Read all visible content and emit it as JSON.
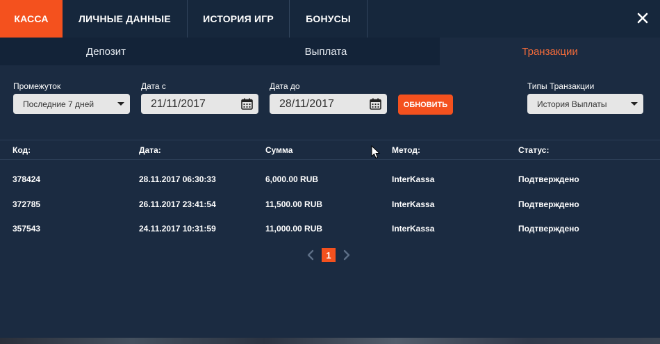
{
  "top_tabs": [
    {
      "label": "КАССА",
      "active": true
    },
    {
      "label": "ЛИЧНЫЕ ДАННЫЕ",
      "active": false
    },
    {
      "label": "ИСТОРИЯ ИГР",
      "active": false
    },
    {
      "label": "БОНУСЫ",
      "active": false
    }
  ],
  "close_icon": "close-icon",
  "sub_tabs": [
    {
      "label": "Депозит",
      "active": false
    },
    {
      "label": "Выплата",
      "active": false
    },
    {
      "label": "Транзакции",
      "active": true
    }
  ],
  "filters": {
    "period_label": "Промежуток",
    "period_value": "Последние 7 дней",
    "date_from_label": "Дата с",
    "date_from_value": "21/11/2017",
    "date_to_label": "Дата до",
    "date_to_value": "28/11/2017",
    "refresh_label": "ОБНОВИТЬ",
    "type_label": "Типы Транзакции",
    "type_value": "История Выплаты"
  },
  "table": {
    "headers": [
      "Код:",
      "Дата:",
      "Сумма",
      "Метод:",
      "Статус:"
    ],
    "rows": [
      [
        "378424",
        "28.11.2017 06:30:33",
        "6,000.00 RUB",
        "InterKassa",
        "Подтверждено"
      ],
      [
        "372785",
        "26.11.2017 23:41:54",
        "11,500.00 RUB",
        "InterKassa",
        "Подтверждено"
      ],
      [
        "357543",
        "24.11.2017 10:31:59",
        "11,000.00 RUB",
        "InterKassa",
        "Подтверждено"
      ]
    ]
  },
  "pagination": {
    "current": "1"
  },
  "colors": {
    "accent": "#f4511e",
    "background": "#1b2b41",
    "tab_active_text": "#f26b3a"
  }
}
